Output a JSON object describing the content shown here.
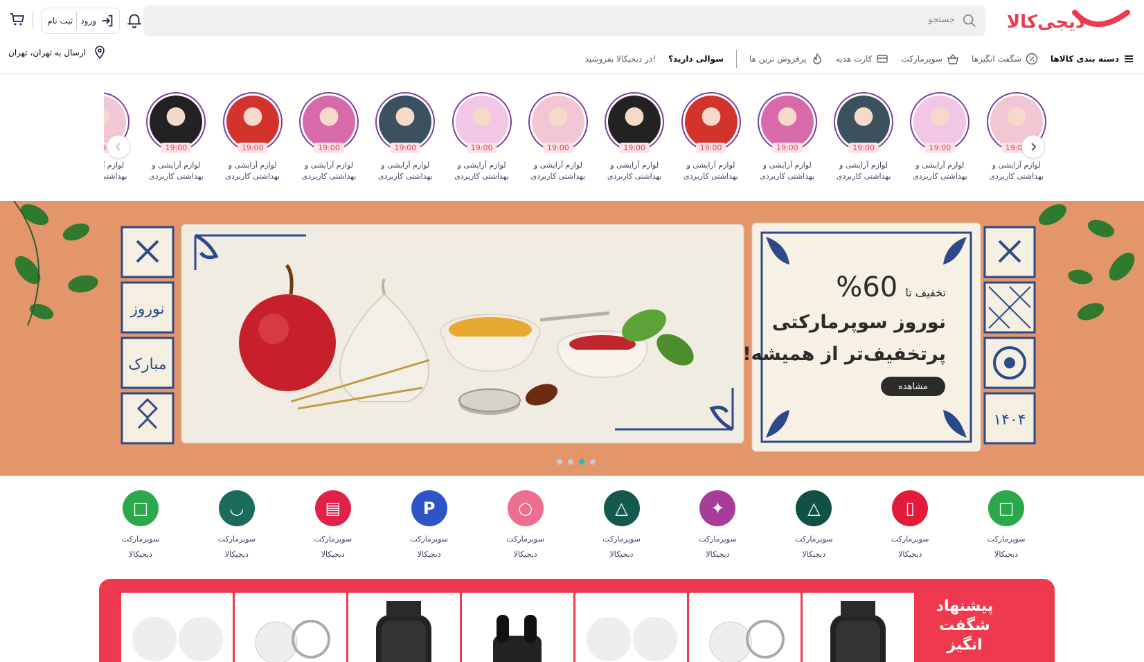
{
  "header": {
    "brand": "دیجی‌کالا",
    "search_placeholder": "جستجو",
    "login_label": "ورود",
    "register_label": "ثبت نام"
  },
  "nav": {
    "categories": "دسته بندی کالاها",
    "items": [
      {
        "label": "شگفت انگیزها",
        "icon": "percent-icon"
      },
      {
        "label": "سوپرمارکت",
        "icon": "basket-icon"
      },
      {
        "label": "کارت هدیه",
        "icon": "gift-card-icon"
      },
      {
        "label": "پرفروش ترین ها",
        "icon": "fire-icon"
      }
    ],
    "faq": "سوالی دارید؟",
    "sell": "در دیجیکالا بفروشید!",
    "location": "ارسال به تهران، تهران"
  },
  "stories": {
    "time": "19:00",
    "caption_line1": "لوازم آرایشی و",
    "caption_line2": "بهداشتی کاربردی",
    "count": 13
  },
  "banner": {
    "line1_prefix": "تخفیف تا",
    "percent": "60%",
    "line2": "نوروز سوپرمارکتی",
    "line3": "پرتخفیف‌تر از همیشه!",
    "cta": "مشاهده",
    "tile_words": [
      "نوروز",
      "مبارک",
      "۱۴۰۴"
    ],
    "active_slide": 3,
    "slides": 4
  },
  "categories": {
    "label_line1": "سوپرمارکت",
    "label_line2": "دیجیکالا",
    "items": [
      {
        "color": "#2aa84a",
        "icon": "basket-icon"
      },
      {
        "color": "#e11b39",
        "icon": "phone-icon"
      },
      {
        "color": "#0f5145",
        "icon": "tent-icon"
      },
      {
        "color": "#a83c9a",
        "icon": "sparkle-icon"
      },
      {
        "color": "#14594d",
        "icon": "tent-icon"
      },
      {
        "color": "#ed6e8e",
        "icon": "ring-icon"
      },
      {
        "color": "#2e55c8",
        "icon": "p-icon"
      },
      {
        "color": "#e02248",
        "icon": "shop-icon"
      },
      {
        "color": "#1b6b5c",
        "icon": "smile-icon"
      },
      {
        "color": "#2aa84a",
        "icon": "basket-icon"
      }
    ]
  },
  "amazing": {
    "title_l1": "پیشنهاد",
    "title_l2": "شگفت",
    "title_l3": "انگیز",
    "products": [
      "watch",
      "keychain",
      "bulbs",
      "earbuds",
      "watch",
      "keychain",
      "bulbs"
    ]
  }
}
